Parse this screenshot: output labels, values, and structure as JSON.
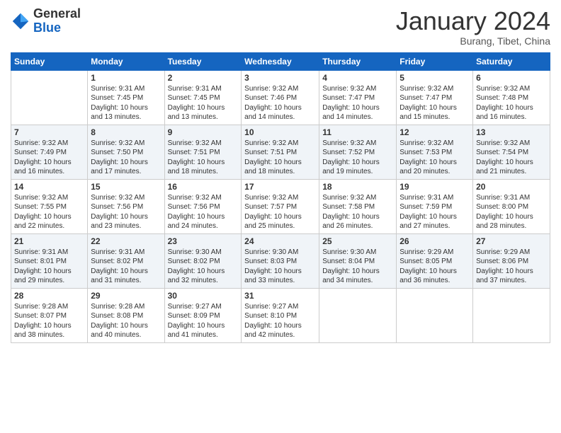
{
  "logo": {
    "text_general": "General",
    "text_blue": "Blue"
  },
  "header": {
    "month": "January 2024",
    "location": "Burang, Tibet, China"
  },
  "weekdays": [
    "Sunday",
    "Monday",
    "Tuesday",
    "Wednesday",
    "Thursday",
    "Friday",
    "Saturday"
  ],
  "weeks": [
    [
      {
        "day": "",
        "detail": ""
      },
      {
        "day": "1",
        "detail": "Sunrise: 9:31 AM\nSunset: 7:45 PM\nDaylight: 10 hours\nand 13 minutes."
      },
      {
        "day": "2",
        "detail": "Sunrise: 9:31 AM\nSunset: 7:45 PM\nDaylight: 10 hours\nand 13 minutes."
      },
      {
        "day": "3",
        "detail": "Sunrise: 9:32 AM\nSunset: 7:46 PM\nDaylight: 10 hours\nand 14 minutes."
      },
      {
        "day": "4",
        "detail": "Sunrise: 9:32 AM\nSunset: 7:47 PM\nDaylight: 10 hours\nand 14 minutes."
      },
      {
        "day": "5",
        "detail": "Sunrise: 9:32 AM\nSunset: 7:47 PM\nDaylight: 10 hours\nand 15 minutes."
      },
      {
        "day": "6",
        "detail": "Sunrise: 9:32 AM\nSunset: 7:48 PM\nDaylight: 10 hours\nand 16 minutes."
      }
    ],
    [
      {
        "day": "7",
        "detail": "Sunrise: 9:32 AM\nSunset: 7:49 PM\nDaylight: 10 hours\nand 16 minutes."
      },
      {
        "day": "8",
        "detail": "Sunrise: 9:32 AM\nSunset: 7:50 PM\nDaylight: 10 hours\nand 17 minutes."
      },
      {
        "day": "9",
        "detail": "Sunrise: 9:32 AM\nSunset: 7:51 PM\nDaylight: 10 hours\nand 18 minutes."
      },
      {
        "day": "10",
        "detail": "Sunrise: 9:32 AM\nSunset: 7:51 PM\nDaylight: 10 hours\nand 18 minutes."
      },
      {
        "day": "11",
        "detail": "Sunrise: 9:32 AM\nSunset: 7:52 PM\nDaylight: 10 hours\nand 19 minutes."
      },
      {
        "day": "12",
        "detail": "Sunrise: 9:32 AM\nSunset: 7:53 PM\nDaylight: 10 hours\nand 20 minutes."
      },
      {
        "day": "13",
        "detail": "Sunrise: 9:32 AM\nSunset: 7:54 PM\nDaylight: 10 hours\nand 21 minutes."
      }
    ],
    [
      {
        "day": "14",
        "detail": "Sunrise: 9:32 AM\nSunset: 7:55 PM\nDaylight: 10 hours\nand 22 minutes."
      },
      {
        "day": "15",
        "detail": "Sunrise: 9:32 AM\nSunset: 7:56 PM\nDaylight: 10 hours\nand 23 minutes."
      },
      {
        "day": "16",
        "detail": "Sunrise: 9:32 AM\nSunset: 7:56 PM\nDaylight: 10 hours\nand 24 minutes."
      },
      {
        "day": "17",
        "detail": "Sunrise: 9:32 AM\nSunset: 7:57 PM\nDaylight: 10 hours\nand 25 minutes."
      },
      {
        "day": "18",
        "detail": "Sunrise: 9:32 AM\nSunset: 7:58 PM\nDaylight: 10 hours\nand 26 minutes."
      },
      {
        "day": "19",
        "detail": "Sunrise: 9:31 AM\nSunset: 7:59 PM\nDaylight: 10 hours\nand 27 minutes."
      },
      {
        "day": "20",
        "detail": "Sunrise: 9:31 AM\nSunset: 8:00 PM\nDaylight: 10 hours\nand 28 minutes."
      }
    ],
    [
      {
        "day": "21",
        "detail": "Sunrise: 9:31 AM\nSunset: 8:01 PM\nDaylight: 10 hours\nand 29 minutes."
      },
      {
        "day": "22",
        "detail": "Sunrise: 9:31 AM\nSunset: 8:02 PM\nDaylight: 10 hours\nand 31 minutes."
      },
      {
        "day": "23",
        "detail": "Sunrise: 9:30 AM\nSunset: 8:02 PM\nDaylight: 10 hours\nand 32 minutes."
      },
      {
        "day": "24",
        "detail": "Sunrise: 9:30 AM\nSunset: 8:03 PM\nDaylight: 10 hours\nand 33 minutes."
      },
      {
        "day": "25",
        "detail": "Sunrise: 9:30 AM\nSunset: 8:04 PM\nDaylight: 10 hours\nand 34 minutes."
      },
      {
        "day": "26",
        "detail": "Sunrise: 9:29 AM\nSunset: 8:05 PM\nDaylight: 10 hours\nand 36 minutes."
      },
      {
        "day": "27",
        "detail": "Sunrise: 9:29 AM\nSunset: 8:06 PM\nDaylight: 10 hours\nand 37 minutes."
      }
    ],
    [
      {
        "day": "28",
        "detail": "Sunrise: 9:28 AM\nSunset: 8:07 PM\nDaylight: 10 hours\nand 38 minutes."
      },
      {
        "day": "29",
        "detail": "Sunrise: 9:28 AM\nSunset: 8:08 PM\nDaylight: 10 hours\nand 40 minutes."
      },
      {
        "day": "30",
        "detail": "Sunrise: 9:27 AM\nSunset: 8:09 PM\nDaylight: 10 hours\nand 41 minutes."
      },
      {
        "day": "31",
        "detail": "Sunrise: 9:27 AM\nSunset: 8:10 PM\nDaylight: 10 hours\nand 42 minutes."
      },
      {
        "day": "",
        "detail": ""
      },
      {
        "day": "",
        "detail": ""
      },
      {
        "day": "",
        "detail": ""
      }
    ]
  ]
}
